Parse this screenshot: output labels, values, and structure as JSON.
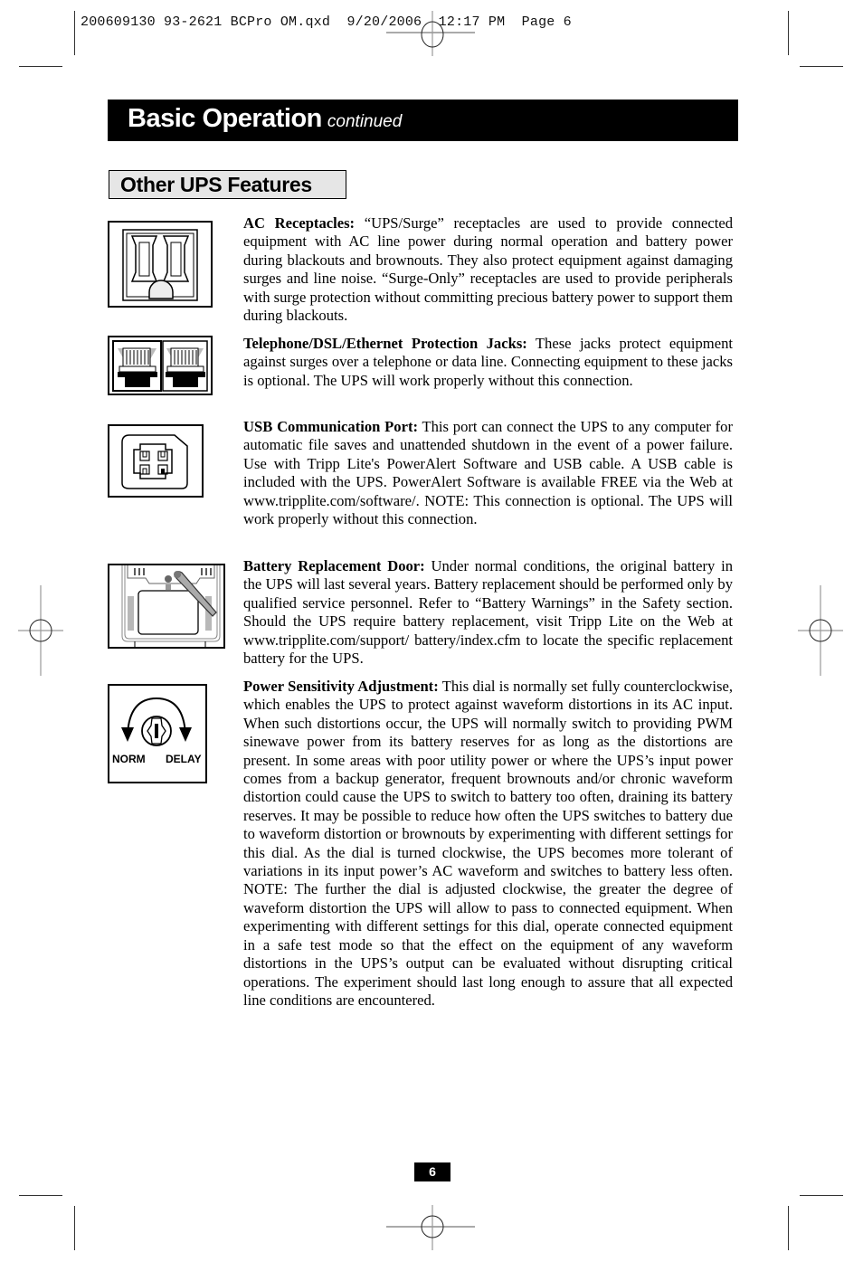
{
  "slug_line": "200609130 93-2621 BCPro OM.qxd  9/20/2006  12:17 PM  Page 6",
  "header": {
    "title": "Basic Operation",
    "subtitle": "continued"
  },
  "section": {
    "title": "Other UPS Features"
  },
  "features": [
    {
      "icon": "ac-receptacle-icon",
      "heading": "AC Receptacles:",
      "body": " “UPS/Surge” receptacles are used to provide connected equipment with AC line power during normal operation and battery power during blackouts and brownouts. They also protect equipment against damaging surges and line noise. “Surge-Only” receptacles are used to provide peripherals with surge protection without committing precious battery power to support them during blackouts."
    },
    {
      "icon": "rj45-jacks-icon",
      "heading": "Telephone/DSL/Ethernet Protection Jacks:",
      "body": " These jacks protect equipment against surges over a telephone or data line. Connecting equipment to these jacks is optional. The UPS will work properly without this connection."
    },
    {
      "icon": "usb-port-icon",
      "heading": "USB Communication Port:",
      "body": " This port can connect the UPS to any computer for automatic file saves and unattended shutdown in the event of a power failure. Use with Tripp Lite's PowerAlert Software and USB cable. A USB cable is included with the UPS. PowerAlert Software is available FREE via the Web at www.tripplite.com/software/. NOTE: This connection is optional. The UPS will work properly without this connection."
    },
    {
      "icon": "battery-door-icon",
      "heading": "Battery Replacement Door:",
      "body": " Under normal conditions, the original battery in the UPS will last several years. Battery replacement should be performed only by qualified service personnel. Refer to “Battery Warnings” in the Safety section. Should the UPS require battery replacement, visit Tripp Lite on the Web at www.tripplite.com/support/ battery/index.cfm to locate the specific replacement battery for the UPS."
    },
    {
      "icon": "sensitivity-dial-icon",
      "heading": "Power Sensitivity Adjustment:",
      "body": " This dial is normally set fully counterclockwise, which enables the UPS to protect against waveform distortions in its AC input. When such distortions occur, the UPS will normally switch to providing PWM sinewave power from its battery reserves for as long as the distortions are present. In some areas with poor utility power or where the UPS’s input power comes from a backup generator, frequent brownouts and/or chronic waveform distortion could cause the UPS to switch to battery too often, draining its battery reserves. It may be possible to reduce how often the UPS switches to battery due to waveform distortion or brownouts by experimenting with different settings for this dial. As the dial is turned clockwise, the UPS becomes more tolerant of variations in its input power’s AC waveform and switches to battery less often. NOTE: The further the dial is adjusted clockwise, the greater the degree of waveform distortion the UPS will allow to pass to connected equipment. When experimenting with different settings for this dial, operate connected equipment in a safe test mode so that the effect on the equipment of any waveform distortions in the UPS’s output can be evaluated without disrupting critical operations. The experiment should last long enough to assure that all expected line conditions are encountered."
    }
  ],
  "dial_labels": {
    "left": "NORM",
    "right": "DELAY"
  },
  "page_number": "6"
}
